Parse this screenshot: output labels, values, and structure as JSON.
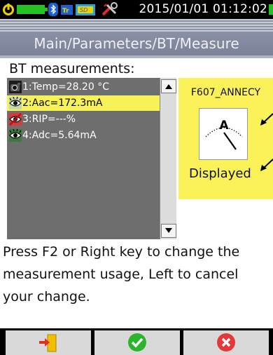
{
  "status_bar": {
    "datetime": "2015/01/01 01:12:02",
    "icons": [
      "power-icon",
      "battery-icon",
      "bluetooth-icon",
      "tr-icon",
      "sd-card-icon",
      "tools-icon",
      "battery-end-icon"
    ]
  },
  "header": {
    "breadcrumb": "Main/Parameters/BT/Measure"
  },
  "section": {
    "label": "BT measurements:"
  },
  "measurements": [
    {
      "label": "1:Temp=28.20 °C",
      "icon": "camera-icon",
      "selected": false
    },
    {
      "label": "2:Aac=172.3mA",
      "icon": "eye-icon",
      "selected": true
    },
    {
      "label": "3:RIP=---%",
      "icon": "hidden-icon",
      "selected": false
    },
    {
      "label": "4:Adc=5.64mA",
      "icon": "eye-icon",
      "selected": false
    }
  ],
  "info_panel": {
    "device_name": "F607_ANNECY",
    "meter_unit": "A",
    "status": "Displayed"
  },
  "description": "Press F2 or Right key to change the measurement usage, Left to cancel your change.",
  "softkeys": [
    {
      "icon": "exit-icon"
    },
    {
      "icon": "check-icon"
    },
    {
      "icon": "cancel-icon"
    }
  ],
  "colors": {
    "selection": "#f7f257",
    "info_panel": "#fbf25a",
    "list_bg": "#6e6e6e",
    "title_bar": "#7c8299",
    "check": "#2ab52a",
    "cancel": "#e23a3a"
  }
}
